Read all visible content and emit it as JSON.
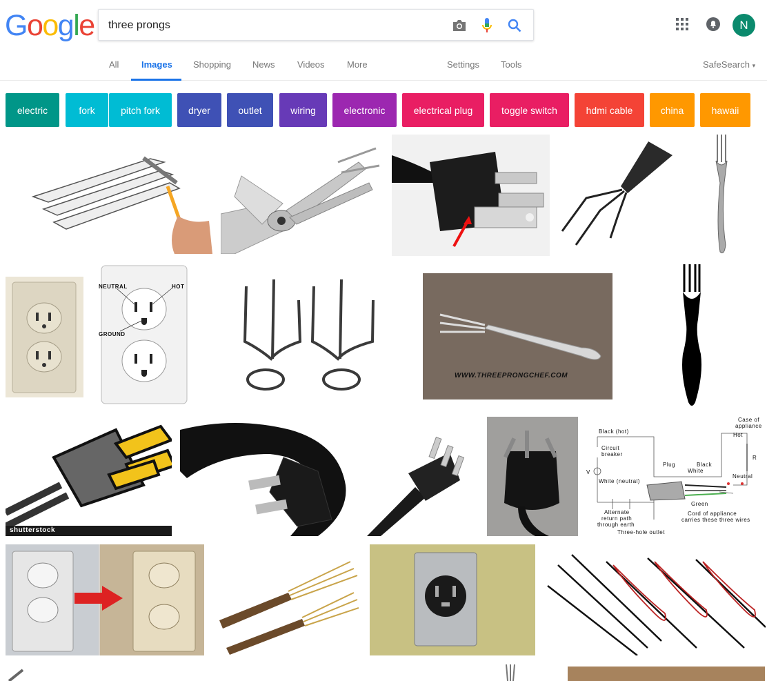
{
  "logo": {
    "letters": [
      "G",
      "o",
      "o",
      "g",
      "l",
      "e"
    ],
    "colors": [
      "#4285f4",
      "#ea4335",
      "#fbbc05",
      "#4285f4",
      "#34a853",
      "#ea4335"
    ]
  },
  "search": {
    "query": "three prongs",
    "placeholder": ""
  },
  "icons": {
    "camera": "camera-icon",
    "mic": "mic-icon",
    "search": "search-icon",
    "apps": "apps-grid-icon",
    "notifications": "notification-bell-icon"
  },
  "user": {
    "initial": "N",
    "avatar_color": "#0b8a6d"
  },
  "tabs": {
    "all": "All",
    "images": "Images",
    "shopping": "Shopping",
    "news": "News",
    "videos": "Videos",
    "more": "More",
    "settings": "Settings",
    "tools": "Tools",
    "safesearch": "SafeSearch"
  },
  "chips": [
    {
      "label": "electric",
      "color": "#009688"
    },
    {
      "label": "fork",
      "color": "#00bcd4"
    },
    {
      "label": "pitch fork",
      "color": "#00bcd4"
    },
    {
      "label": "dryer",
      "color": "#3f51b5"
    },
    {
      "label": "outlet",
      "color": "#3f51b5"
    },
    {
      "label": "wiring",
      "color": "#673ab7"
    },
    {
      "label": "electronic",
      "color": "#9c27b0"
    },
    {
      "label": "electrical plug",
      "color": "#e91e63"
    },
    {
      "label": "toggle switch",
      "color": "#e91e63"
    },
    {
      "label": "hdmi cable",
      "color": "#f44336"
    },
    {
      "label": "china",
      "color": "#ff9800"
    },
    {
      "label": "hawaii",
      "color": "#ff9800"
    }
  ],
  "images": {
    "outlet_labels": {
      "neutral": "NEUTRAL",
      "hot": "HOT",
      "ground": "GROUND"
    },
    "chef_watermark": "WWW.THREEPRONGCHEF.COM",
    "shutterstock_watermark": "shutterstock",
    "diagram_labels": {
      "black_hot": "Black (hot)",
      "circuit_breaker_1": "Circuit",
      "circuit_breaker_2": "breaker",
      "v": "V",
      "white_neutral": "White (neutral)",
      "plug": "Plug",
      "black": "Black",
      "white": "White",
      "green": "Green",
      "case_1": "Case of",
      "case_2": "appliance",
      "hot": "Hot",
      "r": "R",
      "neutral": "Neutral",
      "alt_1": "Alternate",
      "alt_2": "return path",
      "alt_3": "through earth",
      "cord_1": "Cord of appliance",
      "cord_2": "carries these three wires",
      "outlet": "Three-hole outlet"
    }
  }
}
